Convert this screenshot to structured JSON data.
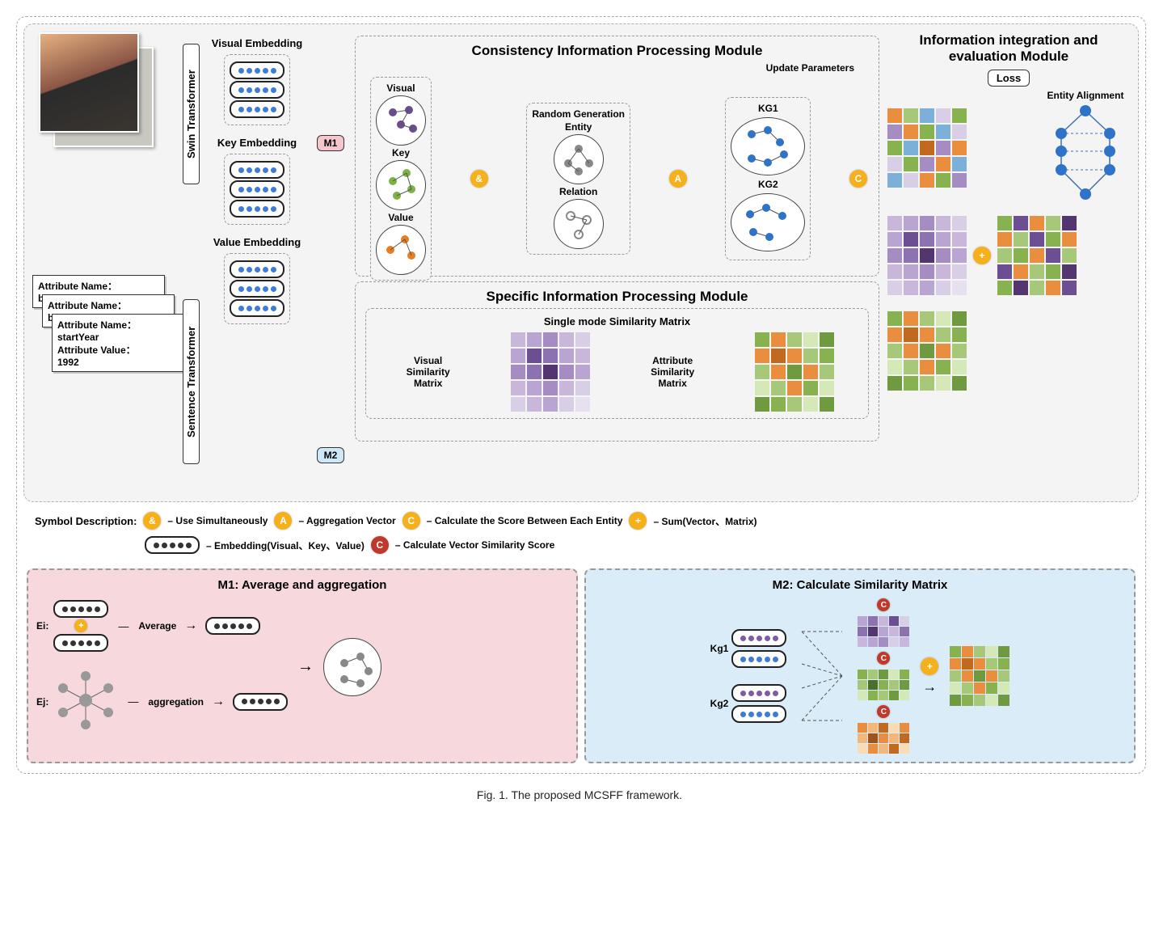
{
  "caption": "Fig. 1.  The proposed MCSFF framework.",
  "modules": {
    "consistency": "Consistency Information Processing Module",
    "specific": "Specific Information Processing Module",
    "integration": "Information integration and evaluation Module",
    "single_mode": "Single mode Similarity Matrix"
  },
  "encoders": {
    "swin": "Swin Transformer",
    "sentence": "Sentence Transformer"
  },
  "embeddings": {
    "visual": "Visual Embedding",
    "key": "Key Embedding",
    "value": "Value Embedding"
  },
  "cipm_labels": {
    "visual": "Visual",
    "key": "Key",
    "value": "Value",
    "random_gen": "Random Generation",
    "entity": "Entity",
    "relation": "Relation",
    "kg1": "KG1",
    "kg2": "KG2",
    "update_params": "Update Parameters"
  },
  "sipm_labels": {
    "visual_sim": "Visual Similarity Matrix",
    "attr_sim": "Attribute Similarity Matrix"
  },
  "integration_labels": {
    "loss": "Loss",
    "entity_align": "Entity Alignment"
  },
  "tags": {
    "m1": "M1",
    "m2": "M2"
  },
  "attr_cards": {
    "c1_name": "Attribute Name：",
    "c1_val": "birthYear",
    "c2_name": "Attribute Name：",
    "c2_val": "birthDate",
    "c3_name": "Attribute Name：",
    "c3_name_val": "startYear",
    "c3_val_label": "Attribute Value：",
    "c3_val": "1992"
  },
  "legend": {
    "title": "Symbol Description:",
    "and": "– Use Simultaneously",
    "A": "– Aggregation Vector",
    "C": "– Calculate the Score Between Each Entity",
    "plus": "– Sum(Vector、Matrix)",
    "embedding": "– Embedding(Visual、Key、Value)",
    "c_red": "– Calculate Vector Similarity Score"
  },
  "m1_panel": {
    "title": "M1: Average and aggregation",
    "Ei": "Ei:",
    "Ej": "Ej:",
    "average": "Average",
    "aggregation": "aggregation"
  },
  "m2_panel": {
    "title": "M2: Calculate Similarity Matrix",
    "kg1": "Kg1",
    "kg2": "Kg2"
  }
}
